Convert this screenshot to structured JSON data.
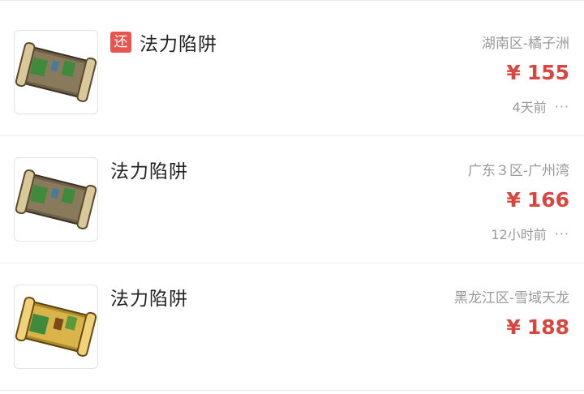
{
  "listings": [
    {
      "badge": "还",
      "title": "法力陷阱",
      "server": "湖南区-橘子洲",
      "currency": "¥",
      "price": "155",
      "time": "4天前",
      "more": "···"
    },
    {
      "title": "法力陷阱",
      "server": "广东３区-广州湾",
      "currency": "¥",
      "price": "166",
      "time": "12小时前",
      "more": "···"
    },
    {
      "title": "法力陷阱",
      "server": "黑龙江区-雪域天龙",
      "currency": "¥",
      "price": "188"
    }
  ]
}
